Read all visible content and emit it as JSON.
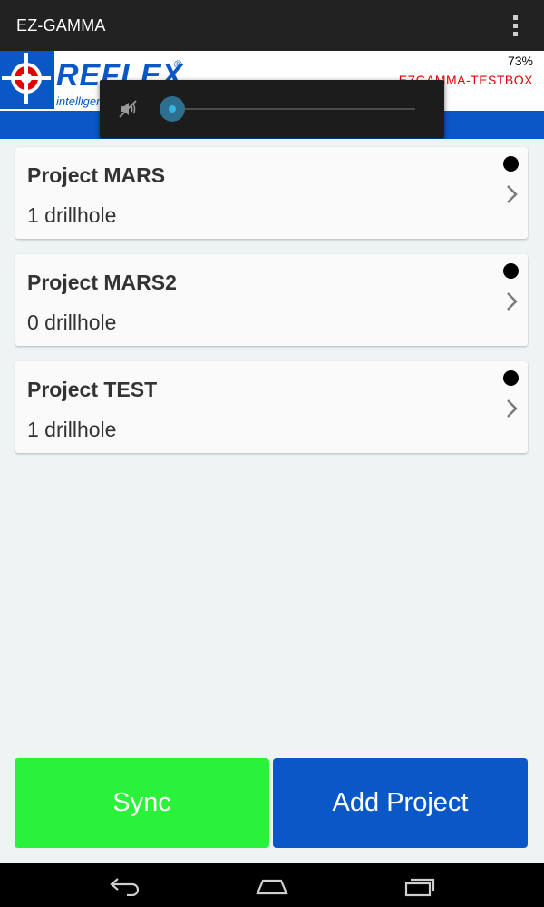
{
  "action_bar": {
    "title": "EZ-GAMMA",
    "overflow_icon": "more-vert-icon"
  },
  "header": {
    "logo_word": "REFLEX",
    "logo_reg": "®",
    "logo_tagline": "intelligen",
    "battery": "73%",
    "device_name": "EZGAMMA-TESTBOX",
    "colors": {
      "brand_blue": "#0a58c8",
      "device_red": "#e00000"
    }
  },
  "volume_popup": {
    "icon": "volume-muted-icon",
    "level": 0
  },
  "projects": [
    {
      "name": "Project MARS",
      "subtitle": "1 drillhole"
    },
    {
      "name": "Project MARS2",
      "subtitle": "0 drillhole"
    },
    {
      "name": "Project TEST",
      "subtitle": "1 drillhole"
    }
  ],
  "buttons": {
    "sync_label": "Sync",
    "add_label": "Add Project",
    "colors": {
      "sync": "#2af23a",
      "add": "#0a58c8"
    }
  },
  "nav": {
    "back_icon": "back-icon",
    "home_icon": "home-icon",
    "recents_icon": "recents-icon"
  }
}
